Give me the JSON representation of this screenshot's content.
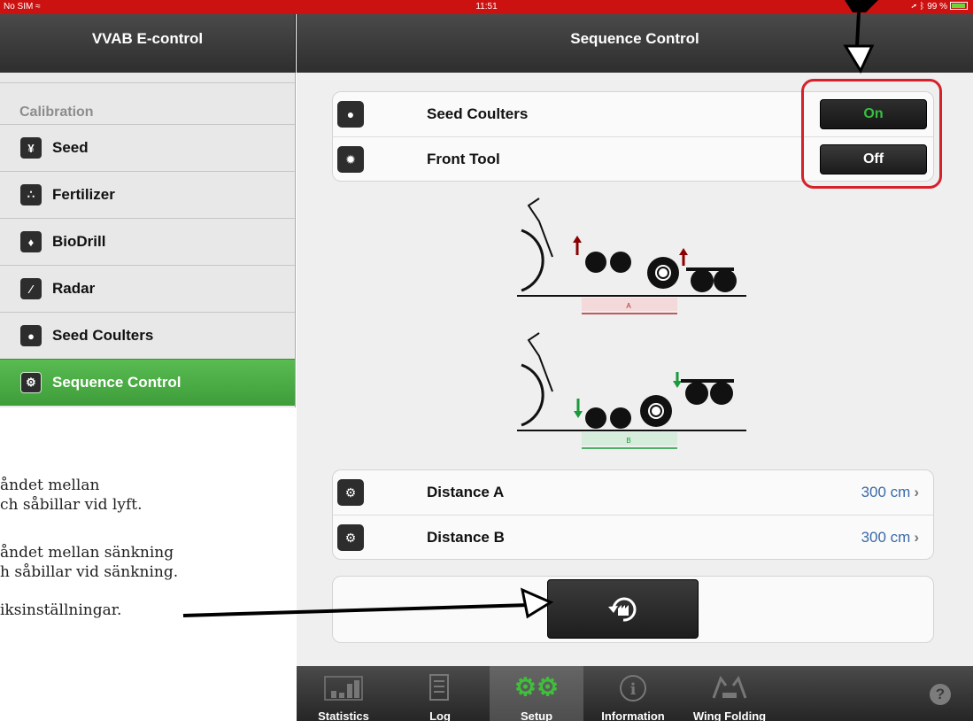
{
  "status_bar": {
    "carrier": "No SIM",
    "time": "11:51",
    "battery": "99 %"
  },
  "left_pane": {
    "title": "VVAB E-control",
    "section": "Calibration",
    "items": [
      {
        "label": "Seed",
        "icon": "seed-icon"
      },
      {
        "label": "Fertilizer",
        "icon": "fertilizer-icon"
      },
      {
        "label": "BioDrill",
        "icon": "biodrill-icon"
      },
      {
        "label": "Radar",
        "icon": "radar-icon"
      },
      {
        "label": "Seed Coulters",
        "icon": "seed-coulters-icon"
      },
      {
        "label": "Sequence Control",
        "icon": "gears-icon",
        "active": true
      }
    ]
  },
  "annotations": {
    "note1_line1": "åndet mellan",
    "note1_line2": "ch såbillar vid lyft.",
    "note2_line1": "åndet mellan sänkning",
    "note2_line2": "h såbillar vid sänkning.",
    "note3": "iksinställningar."
  },
  "main": {
    "title": "Sequence Control",
    "toggles": [
      {
        "label": "Seed Coulters",
        "value": "On",
        "state": "on"
      },
      {
        "label": "Front Tool",
        "value": "Off",
        "state": "off"
      }
    ],
    "diagram": {
      "label_a": "A",
      "label_b": "B"
    },
    "distances": [
      {
        "label": "Distance A",
        "value": "300 cm"
      },
      {
        "label": "Distance B",
        "value": "300 cm"
      }
    ]
  },
  "tabbar": {
    "tabs": [
      {
        "label": "Statistics",
        "icon": "statistics-icon"
      },
      {
        "label": "Log",
        "icon": "log-icon"
      },
      {
        "label": "Setup",
        "icon": "setup-gears-icon",
        "active": true
      },
      {
        "label": "Information",
        "icon": "information-icon"
      },
      {
        "label": "Wing Folding",
        "icon": "wing-folding-icon"
      }
    ],
    "help": "?"
  },
  "colors": {
    "accent_green": "#4caf50",
    "status_red": "#cc1111",
    "highlight_red": "#d6202a",
    "value_blue": "#3b6aa8"
  }
}
